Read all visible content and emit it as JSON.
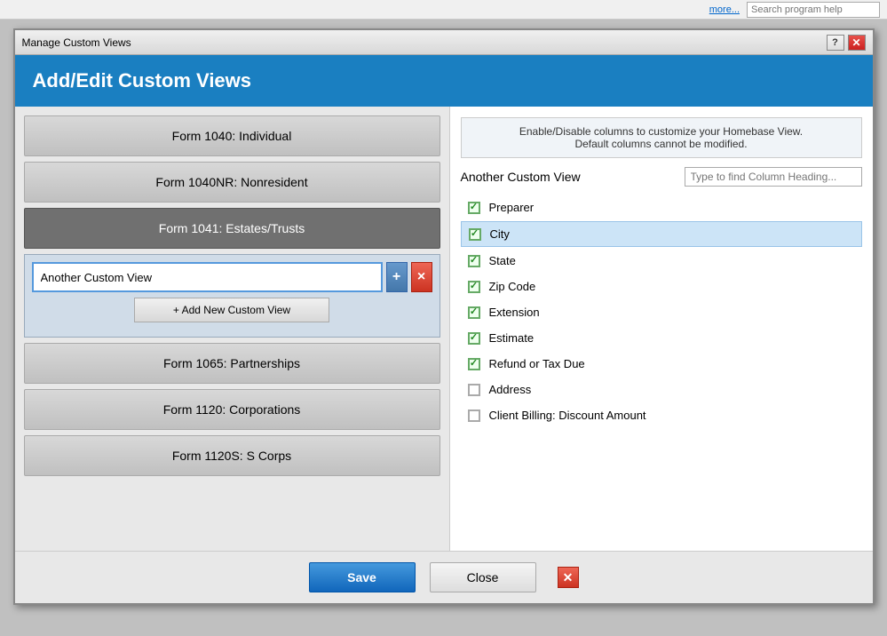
{
  "topbar": {
    "more_label": "more...",
    "search_placeholder": "Search program help"
  },
  "dialog": {
    "title": "Manage Custom Views",
    "header": "Add/Edit Custom Views",
    "hint_line1": "Enable/Disable columns to customize your Homebase View.",
    "hint_line2": "Default columns cannot be modified.",
    "view_name": "Another Custom View",
    "column_search_placeholder": "Type to find Column Heading...",
    "save_label": "Save",
    "close_label": "Close"
  },
  "left_items": [
    {
      "id": "form1040",
      "label": "Form 1040:  Individual",
      "active": false
    },
    {
      "id": "form1040nr",
      "label": "Form 1040NR:  Nonresident",
      "active": false
    },
    {
      "id": "form1041",
      "label": "Form 1041:  Estates/Trusts",
      "active": true
    },
    {
      "id": "form1065",
      "label": "Form 1065:  Partnerships",
      "active": false
    },
    {
      "id": "form1120",
      "label": "Form 1120:  Corporations",
      "active": false
    },
    {
      "id": "form1120s",
      "label": "Form 1120S:  S Corps",
      "active": false
    }
  ],
  "custom_view": {
    "input_value": "Another Custom View",
    "add_label": "+",
    "del_label": "×",
    "add_new_label": "+ Add New Custom View"
  },
  "columns": [
    {
      "id": "preparer",
      "label": "Preparer",
      "checked": true,
      "highlighted": false
    },
    {
      "id": "city",
      "label": "City",
      "checked": true,
      "highlighted": true
    },
    {
      "id": "state",
      "label": "State",
      "checked": true,
      "highlighted": false
    },
    {
      "id": "zipcode",
      "label": "Zip Code",
      "checked": true,
      "highlighted": false
    },
    {
      "id": "extension",
      "label": "Extension",
      "checked": true,
      "highlighted": false
    },
    {
      "id": "estimate",
      "label": "Estimate",
      "checked": true,
      "highlighted": false
    },
    {
      "id": "refund",
      "label": "Refund or Tax Due",
      "checked": true,
      "highlighted": false
    },
    {
      "id": "address",
      "label": "Address",
      "checked": false,
      "highlighted": false
    },
    {
      "id": "clientbilling",
      "label": "Client Billing: Discount Amount",
      "checked": false,
      "highlighted": false
    }
  ],
  "icons": {
    "help": "?",
    "close_dialog": "✕",
    "plus": "+",
    "times": "×",
    "checkmark": "✓",
    "scrolldown": "▼"
  }
}
